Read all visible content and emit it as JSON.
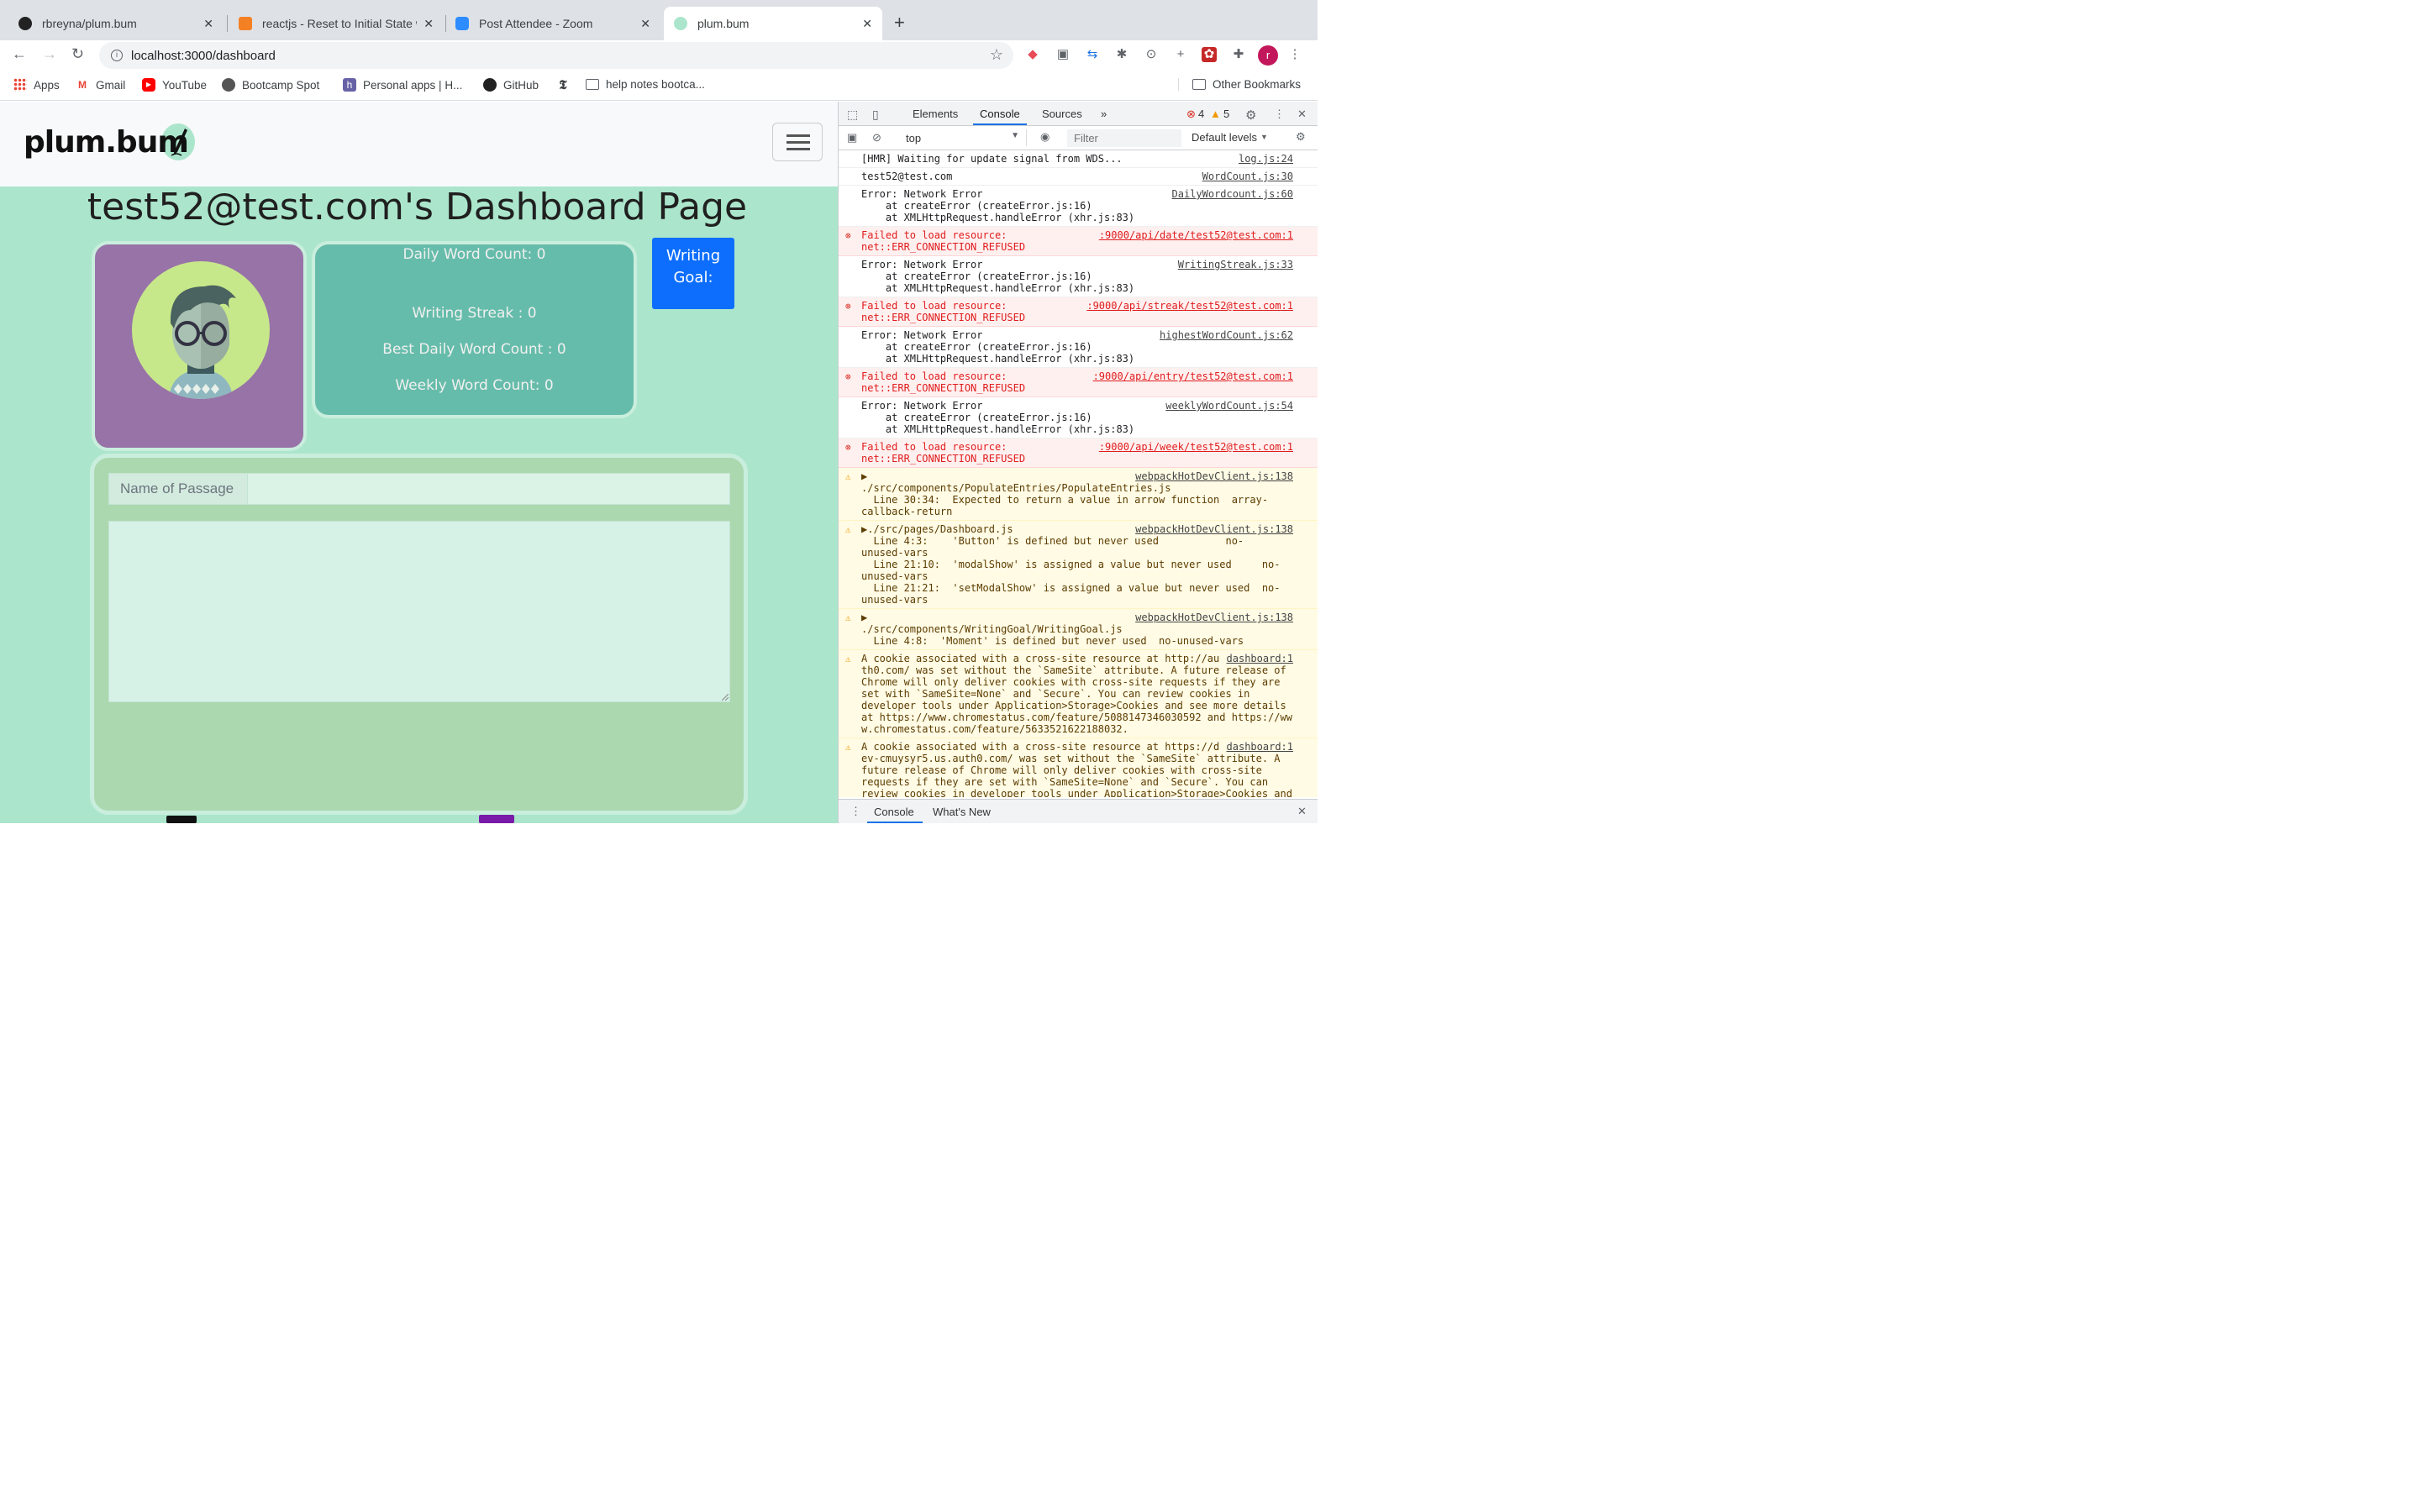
{
  "tabs": [
    {
      "title": "rbreyna/plum.bum",
      "icon": "github-icon"
    },
    {
      "title": "reactjs - Reset to Initial State w",
      "icon": "stackoverflow-icon"
    },
    {
      "title": "Post Attendee - Zoom",
      "icon": "zoom-icon"
    },
    {
      "title": "plum.bum",
      "icon": "plumbum-icon"
    }
  ],
  "url": "localhost:3000/dashboard",
  "profile_initial": "r",
  "bookmarks": [
    "Apps",
    "Gmail",
    "YouTube",
    "Bootcamp Spot",
    "Personal apps | H...",
    "GitHub",
    "help notes bootca..."
  ],
  "other_bookmarks": "Other Bookmarks",
  "app": {
    "logo": "plum.bum",
    "title": "test52@test.com's Dashboard Page",
    "stats": {
      "daily": "Daily Word Count: 0",
      "streak": "Writing Streak : 0",
      "best": "Best Daily Word Count : 0",
      "weekly": "Weekly Word Count: 0"
    },
    "goal_line1": "Writing",
    "goal_line2": "Goal:",
    "passage_label": "Name of Passage"
  },
  "devtools": {
    "tabs": [
      "Elements",
      "Console",
      "Sources"
    ],
    "error_count": "4",
    "warning_count": "5",
    "context": "top",
    "filter_placeholder": "Filter",
    "levels": "Default levels",
    "drawer_tabs": [
      "Console",
      "What's New"
    ],
    "messages": [
      {
        "type": "log",
        "text": "[HMR] Waiting for update signal from WDS...",
        "src": "log.js:24"
      },
      {
        "type": "log",
        "text": "test52@test.com",
        "src": "WordCount.js:30"
      },
      {
        "type": "log",
        "text": "Error: Network Error\n    at createError (createError.js:16)\n    at XMLHttpRequest.handleError (xhr.js:83)",
        "src": "DailyWordcount.js:60"
      },
      {
        "type": "err",
        "text": "Failed to load resource:\nnet::ERR_CONNECTION_REFUSED",
        "src": ":9000/api/date/test52@test.com:1"
      },
      {
        "type": "log",
        "text": "Error: Network Error\n    at createError (createError.js:16)\n    at XMLHttpRequest.handleError (xhr.js:83)",
        "src": "WritingStreak.js:33"
      },
      {
        "type": "err",
        "text": "Failed to load resource:\nnet::ERR_CONNECTION_REFUSED",
        "src": ":9000/api/streak/test52@test.com:1"
      },
      {
        "type": "log",
        "text": "Error: Network Error\n    at createError (createError.js:16)\n    at XMLHttpRequest.handleError (xhr.js:83)",
        "src": "highestWordCount.js:62"
      },
      {
        "type": "err",
        "text": "Failed to load resource:\nnet::ERR_CONNECTION_REFUSED",
        "src": ":9000/api/entry/test52@test.com:1"
      },
      {
        "type": "log",
        "text": "Error: Network Error\n    at createError (createError.js:16)\n    at XMLHttpRequest.handleError (xhr.js:83)",
        "src": "weeklyWordCount.js:54"
      },
      {
        "type": "err",
        "text": "Failed to load resource:\nnet::ERR_CONNECTION_REFUSED",
        "src": ":9000/api/week/test52@test.com:1"
      },
      {
        "type": "warn",
        "text": "▶\n./src/components/PopulateEntries/PopulateEntries.js\n  Line 30:34:  Expected to return a value in arrow function  array-\ncallback-return",
        "src": "webpackHotDevClient.js:138"
      },
      {
        "type": "warn",
        "text": "▶./src/pages/Dashboard.js\n  Line 4:3:    'Button' is defined but never used           no-\nunused-vars\n  Line 21:10:  'modalShow' is assigned a value but never used     no-\nunused-vars\n  Line 21:21:  'setModalShow' is assigned a value but never used  no-\nunused-vars",
        "src": "webpackHotDevClient.js:138"
      },
      {
        "type": "warn",
        "text": "▶\n./src/components/WritingGoal/WritingGoal.js\n  Line 4:8:  'Moment' is defined but never used  no-unused-vars",
        "src": "webpackHotDevClient.js:138"
      },
      {
        "type": "warn",
        "text": "A cookie associated with a cross-site resource at http://au\nth0.com/ was set without the `SameSite` attribute. A future release of\nChrome will only deliver cookies with cross-site requests if they are\nset with `SameSite=None` and `Secure`. You can review cookies in\ndeveloper tools under Application>Storage>Cookies and see more details\nat https://www.chromestatus.com/feature/5088147346030592 and https://ww\nw.chromestatus.com/feature/5633521622188032.",
        "src": "dashboard:1"
      },
      {
        "type": "warn",
        "text": "A cookie associated with a cross-site resource at https://d\nev-cmuysyr5.us.auth0.com/ was set without the `SameSite` attribute. A\nfuture release of Chrome will only deliver cookies with cross-site\nrequests if they are set with `SameSite=None` and `Secure`. You can\nreview cookies in developer tools under Application>Storage>Cookies and",
        "src": "dashboard:1"
      }
    ]
  },
  "colors": {
    "page_bg": "#abe6cc",
    "avatar_card": "#9873a8",
    "stats_card": "#66bcaa",
    "goal_button": "#0d6efd",
    "entry_card": "#acd8b0"
  }
}
